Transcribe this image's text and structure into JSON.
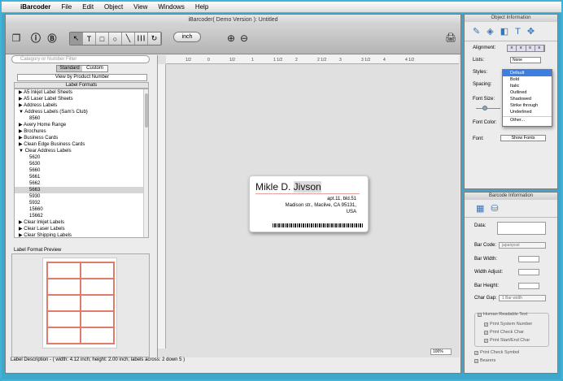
{
  "menubar": {
    "apple": "",
    "items": [
      "iBarcoder",
      "File",
      "Edit",
      "Object",
      "View",
      "Windows",
      "Help"
    ]
  },
  "window": {
    "title": "iBarcoder( Demo Version ): Untitled"
  },
  "toolbar": {
    "tools": [
      "↖",
      "T",
      "□",
      "○",
      "╲",
      "┃┃┃",
      "↻"
    ],
    "units": "inch",
    "zoom_in": "⊕",
    "zoom_out": "⊖",
    "print": "🖨"
  },
  "left": {
    "search_placeholder": "Category or Number Filter",
    "seg": [
      "Standard",
      "Custom"
    ],
    "view_button": "View by Product Number",
    "formats_header": "Label Formats",
    "rows": [
      {
        "t": "▶ A5 Inkjet Label Sheets",
        "c": false
      },
      {
        "t": "▶ A5 Laser Label Sheets",
        "c": false
      },
      {
        "t": "▶ Address Labels",
        "c": false
      },
      {
        "t": "▼ Address Labels (Sam's Club)",
        "c": false
      },
      {
        "t": "8560",
        "c": true
      },
      {
        "t": "▶ Avery Home Range",
        "c": false
      },
      {
        "t": "▶ Brochures",
        "c": false
      },
      {
        "t": "▶ Business Cards",
        "c": false
      },
      {
        "t": "▶ Clean Edge  Business Cards",
        "c": false
      },
      {
        "t": "▼ Clear Address Labels",
        "c": false
      },
      {
        "t": "5620",
        "c": true
      },
      {
        "t": "5630",
        "c": true
      },
      {
        "t": "5660",
        "c": true
      },
      {
        "t": "5661",
        "c": true
      },
      {
        "t": "5662",
        "c": true
      },
      {
        "t": "5663",
        "c": true,
        "s": true
      },
      {
        "t": "5930",
        "c": true
      },
      {
        "t": "5932",
        "c": true
      },
      {
        "t": "15660",
        "c": true
      },
      {
        "t": "15662",
        "c": true
      },
      {
        "t": "▶ Clear Inkjet Labels",
        "c": false
      },
      {
        "t": "▶ Clear Laser Labels",
        "c": false
      },
      {
        "t": "▶ Clear Shipping Labels",
        "c": false
      }
    ],
    "preview_label": "Label Format Preview"
  },
  "canvas": {
    "ruler_marks": [
      "1/2",
      "0",
      "1/2",
      "1",
      "1 1/2",
      "2",
      "2 1/2",
      "3",
      "3 1/2",
      "4",
      "4 1/2"
    ],
    "label_name_a": "Mikle D. ",
    "label_name_b": "Jivson",
    "addr1": "apt.11, bld.51",
    "addr2": "Madison str., Maclive, CA 95131,",
    "addr3": "USA",
    "zoom": "100%"
  },
  "status": "Label Description - ( width: 4.12 inch; height: 2.00 inch; labels across: 2 down 5 )",
  "obj": {
    "title": "Object Information",
    "alignment": "Alignment:",
    "lists": "Lists:",
    "lists_val": "None",
    "styles": "Styles:",
    "spacing": "Spacing:",
    "font_size": "Font Size:",
    "font_color": "Font Color:",
    "font": "Font:",
    "show_fonts": "Show Fonts",
    "style_options": [
      "Default",
      "Bold",
      "Italic",
      "Outlined",
      "Shadowed",
      "Strike through",
      "Underlined",
      "",
      "Other..."
    ]
  },
  "bc": {
    "title": "Barcode Information",
    "data": "Data:",
    "type": "Bar Code:",
    "type_val": "japanpost",
    "width": "Bar Width:",
    "adjust": "Width Adjust:",
    "height": "Bar Height:",
    "gap": "Char Gap:",
    "gap_val": "1 Bar width",
    "checks": [
      "Human Readable Text",
      "Print System Number",
      "Print Check Char",
      "Print Start/End Char",
      "Print Check Symbol",
      "Bearers"
    ]
  }
}
